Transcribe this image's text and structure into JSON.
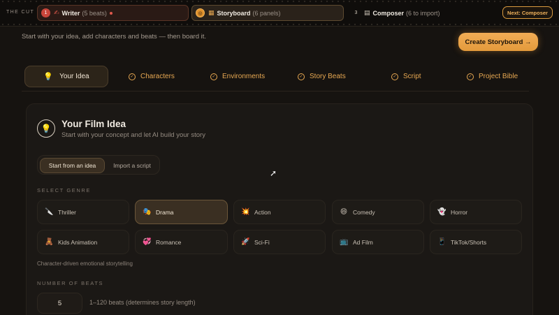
{
  "brand": "THE CUT",
  "pipeline": {
    "writer": {
      "num": "1",
      "label": "Writer",
      "sub": "(5 beats)"
    },
    "storyboard": {
      "label": "Storyboard",
      "sub": "(6 panels)"
    },
    "composer": {
      "num": "3",
      "label": "Composer",
      "sub": "(6 to import)"
    },
    "next_label": "Next: Composer"
  },
  "intro_text": "Start with your idea, add characters and beats — then board it.",
  "create_button": "Create Storyboard →",
  "tabs": [
    {
      "label": "Your Idea",
      "icon": "lightbulb-icon",
      "active": true
    },
    {
      "label": "Characters",
      "icon": "check-circle-icon"
    },
    {
      "label": "Environments",
      "icon": "check-circle-icon"
    },
    {
      "label": "Story Beats",
      "icon": "check-circle-icon"
    },
    {
      "label": "Script",
      "icon": "check-circle-icon"
    },
    {
      "label": "Project Bible",
      "icon": "check-circle-icon"
    }
  ],
  "card": {
    "title": "Your Film Idea",
    "subtitle": "Start with your concept and let AI build your story",
    "toggle": {
      "start": "Start from an idea",
      "import": "Import a script"
    },
    "genre_label": "SELECT GENRE",
    "genres": [
      {
        "label": "Thriller",
        "icon": "🔪"
      },
      {
        "label": "Drama",
        "icon": "🎭",
        "selected": true
      },
      {
        "label": "Action",
        "icon": "💥"
      },
      {
        "label": "Comedy",
        "icon": "😄"
      },
      {
        "label": "Horror",
        "icon": "👻"
      },
      {
        "label": "Kids Animation",
        "icon": "🧸"
      },
      {
        "label": "Romance",
        "icon": "💞"
      },
      {
        "label": "Sci-Fi",
        "icon": "🚀"
      },
      {
        "label": "Ad Film",
        "icon": "📺"
      },
      {
        "label": "TikTok/Shorts",
        "icon": "📱"
      }
    ],
    "genre_description": "Character-driven emotional storytelling",
    "beats_label": "NUMBER OF BEATS",
    "beats_value": "5",
    "beats_hint": "1–120 beats (determines story length)"
  },
  "colors": {
    "accent": "#e7a852",
    "background": "#161310",
    "alert": "#c8463b"
  }
}
